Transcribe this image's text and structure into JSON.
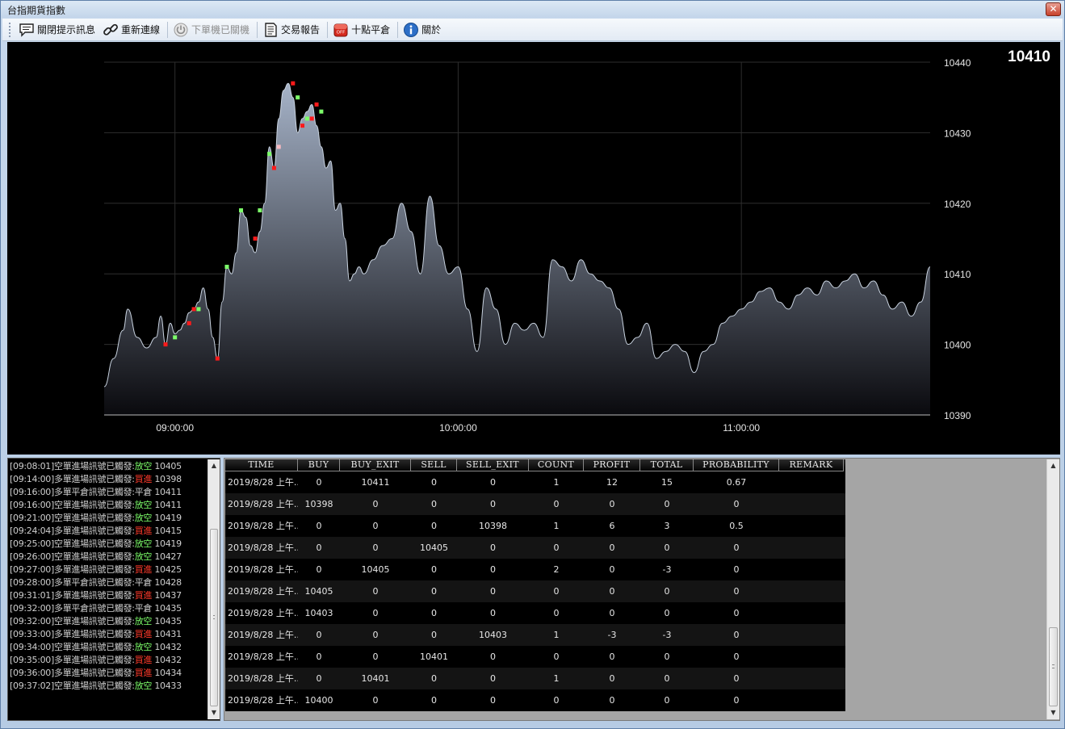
{
  "window": {
    "title": "台指期貨指數",
    "close_label": "✕"
  },
  "toolbar": {
    "items": [
      {
        "label": "關閉提示訊息",
        "icon": "message-icon",
        "disabled": false
      },
      {
        "label": "重新連線",
        "icon": "link-icon",
        "disabled": false
      },
      {
        "label": "下單機已關機",
        "icon": "power-icon",
        "disabled": true
      },
      {
        "label": "交易報告",
        "icon": "report-icon",
        "disabled": false
      },
      {
        "label": "十點平倉",
        "icon": "off-icon",
        "disabled": false
      },
      {
        "label": "關於",
        "icon": "info-icon",
        "disabled": false
      }
    ]
  },
  "price_display": {
    "current": "10410"
  },
  "chart_data": {
    "type": "area",
    "title": "",
    "xlabel": "",
    "ylabel": "",
    "x_axis": {
      "start": "08:45",
      "end": "11:40",
      "ticks": [
        "09:00:00",
        "10:00:00",
        "11:00:00"
      ]
    },
    "ylim": [
      10390,
      10440
    ],
    "y_ticks": [
      10390,
      10400,
      10410,
      10420,
      10430,
      10440
    ],
    "grid": true,
    "colors": {
      "area_top": "#a6b3c8",
      "area_bottom": "#0a0a0e",
      "line": "#c9d3e0",
      "grid": "#2e2e2e",
      "buy_marker": "#ff1a1a",
      "sell_marker": "#7dff6a",
      "exit_marker": "#f4b8c0"
    },
    "series": [
      {
        "x": [
          "08:45",
          "08:47",
          "08:49",
          "08:50",
          "08:52",
          "08:54",
          "08:56",
          "08:57",
          "08:58",
          "08:59",
          "09:00",
          "09:01",
          "09:02",
          "09:03",
          "09:04",
          "09:05",
          "09:06",
          "09:07",
          "09:08",
          "09:09",
          "09:10",
          "09:11",
          "09:12",
          "09:13",
          "09:14",
          "09:15",
          "09:16",
          "09:17",
          "09:18",
          "09:19",
          "09:20",
          "09:21",
          "09:22",
          "09:23",
          "09:24",
          "09:25",
          "09:26",
          "09:27",
          "09:28",
          "09:29",
          "09:30",
          "09:31",
          "09:32",
          "09:33",
          "09:34",
          "09:35",
          "09:36",
          "09:37",
          "09:38",
          "09:39",
          "09:40",
          "09:42",
          "09:44",
          "09:46",
          "09:48",
          "09:50",
          "09:52",
          "09:54",
          "09:56",
          "09:58",
          "10:00",
          "10:02",
          "10:04",
          "10:06",
          "10:08",
          "10:10",
          "10:12",
          "10:14",
          "10:16",
          "10:18",
          "10:20",
          "10:22",
          "10:24",
          "10:26",
          "10:28",
          "10:30",
          "10:32",
          "10:34",
          "10:36",
          "10:38",
          "10:40",
          "10:42",
          "10:44",
          "10:46",
          "10:48",
          "10:50",
          "10:52",
          "10:54",
          "10:56",
          "10:58",
          "11:00",
          "11:02",
          "11:04",
          "11:06",
          "11:08",
          "11:10",
          "11:12",
          "11:14",
          "11:16",
          "11:18",
          "11:20",
          "11:22",
          "11:24",
          "11:26",
          "11:28",
          "11:30",
          "11:32",
          "11:34",
          "11:36",
          "11:38",
          "11:40"
        ],
        "values": [
          10394,
          10398,
          10402,
          10405,
          10401,
          10399.5,
          10401,
          10404,
          10400,
          10403,
          10401.5,
          10402,
          10403,
          10404.5,
          10405,
          10406,
          10408,
          10405,
          10401,
          10398,
          10406,
          10411,
          10410,
          10413,
          10419,
          10418,
          10414,
          10413,
          10416,
          10420,
          10428,
          10425,
          10432,
          10436,
          10437,
          10435,
          10430,
          10432,
          10433,
          10434,
          10431,
          10428,
          10425,
          10426,
          10419,
          10420,
          10415,
          10409,
          10410,
          10411,
          10410,
          10412,
          10414,
          10415,
          10420,
          10416,
          10410,
          10421,
          10414,
          10410,
          10411,
          10405,
          10399,
          10408,
          10405,
          10400,
          10403,
          10402,
          10403,
          10401,
          10412,
          10411,
          10409,
          10412,
          10410,
          10409,
          10408,
          10405,
          10400,
          10401,
          10403,
          10398,
          10399,
          10400,
          10399,
          10396,
          10399,
          10400,
          10403,
          10404,
          10405,
          10406,
          10407.5,
          10408,
          10406,
          10405,
          10407,
          10408,
          10407,
          10409,
          10408,
          10409,
          10410,
          10408,
          10409,
          10407,
          10405,
          10406,
          10404,
          10406,
          10411
        ]
      }
    ],
    "markers": [
      {
        "t": "08:58",
        "v": 10400,
        "kind": "buy"
      },
      {
        "t": "09:00",
        "v": 10401,
        "kind": "sell"
      },
      {
        "t": "09:03",
        "v": 10403,
        "kind": "buy"
      },
      {
        "t": "09:04",
        "v": 10405,
        "kind": "buy"
      },
      {
        "t": "09:05",
        "v": 10405,
        "kind": "sell"
      },
      {
        "t": "09:09",
        "v": 10398,
        "kind": "buy"
      },
      {
        "t": "09:11",
        "v": 10411,
        "kind": "sell"
      },
      {
        "t": "09:14",
        "v": 10419,
        "kind": "sell"
      },
      {
        "t": "09:17",
        "v": 10415,
        "kind": "buy"
      },
      {
        "t": "09:18",
        "v": 10419,
        "kind": "sell"
      },
      {
        "t": "09:20",
        "v": 10427,
        "kind": "sell"
      },
      {
        "t": "09:21",
        "v": 10425,
        "kind": "buy"
      },
      {
        "t": "09:22",
        "v": 10428,
        "kind": "exit"
      },
      {
        "t": "09:25",
        "v": 10437,
        "kind": "buy"
      },
      {
        "t": "09:26",
        "v": 10435,
        "kind": "sell"
      },
      {
        "t": "09:27",
        "v": 10431,
        "kind": "buy"
      },
      {
        "t": "09:28",
        "v": 10432,
        "kind": "sell"
      },
      {
        "t": "09:29",
        "v": 10432,
        "kind": "buy"
      },
      {
        "t": "09:30",
        "v": 10434,
        "kind": "buy"
      },
      {
        "t": "09:31",
        "v": 10433,
        "kind": "sell"
      }
    ]
  },
  "log": {
    "lines": [
      {
        "time": "[09:08:01]",
        "msg": "空單進場訊號已觸發:",
        "action": "放空",
        "price": "10405",
        "kind": "short"
      },
      {
        "time": "[09:14:00]",
        "msg": "多單進場訊號已觸發:",
        "action": "買進",
        "price": "10398",
        "kind": "long"
      },
      {
        "time": "[09:16:00]",
        "msg": "多單平倉訊號已觸發:",
        "action": "平倉",
        "price": "10411",
        "kind": "flat"
      },
      {
        "time": "[09:16:00]",
        "msg": "空單進場訊號已觸發:",
        "action": "放空",
        "price": "10411",
        "kind": "short"
      },
      {
        "time": "[09:21:00]",
        "msg": "空單進場訊號已觸發:",
        "action": "放空",
        "price": "10419",
        "kind": "short"
      },
      {
        "time": "[09:24:04]",
        "msg": "多單進場訊號已觸發:",
        "action": "買進",
        "price": "10415",
        "kind": "long"
      },
      {
        "time": "[09:25:00]",
        "msg": "空單進場訊號已觸發:",
        "action": "放空",
        "price": "10419",
        "kind": "short"
      },
      {
        "time": "[09:26:00]",
        "msg": "空單進場訊號已觸發:",
        "action": "放空",
        "price": "10427",
        "kind": "short"
      },
      {
        "time": "[09:27:00]",
        "msg": "多單進場訊號已觸發:",
        "action": "買進",
        "price": "10425",
        "kind": "long"
      },
      {
        "time": "[09:28:00]",
        "msg": "多單平倉訊號已觸發:",
        "action": "平倉",
        "price": "10428",
        "kind": "flat"
      },
      {
        "time": "[09:31:01]",
        "msg": "多單進場訊號已觸發:",
        "action": "買進",
        "price": "10437",
        "kind": "long"
      },
      {
        "time": "[09:32:00]",
        "msg": "多單平倉訊號已觸發:",
        "action": "平倉",
        "price": "10435",
        "kind": "flat"
      },
      {
        "time": "[09:32:00]",
        "msg": "空單進場訊號已觸發:",
        "action": "放空",
        "price": "10435",
        "kind": "short"
      },
      {
        "time": "[09:33:00]",
        "msg": "多單進場訊號已觸發:",
        "action": "買進",
        "price": "10431",
        "kind": "long"
      },
      {
        "time": "[09:34:00]",
        "msg": "空單進場訊號已觸發:",
        "action": "放空",
        "price": "10432",
        "kind": "short"
      },
      {
        "time": "[09:35:00]",
        "msg": "多單進場訊號已觸發:",
        "action": "買進",
        "price": "10432",
        "kind": "long"
      },
      {
        "time": "[09:36:00]",
        "msg": "多單進場訊號已觸發:",
        "action": "買進",
        "price": "10434",
        "kind": "long"
      },
      {
        "time": "[09:37:02]",
        "msg": "空單進場訊號已觸發:",
        "action": "放空",
        "price": "10433",
        "kind": "short"
      }
    ]
  },
  "trade_table": {
    "columns": [
      "TIME",
      "BUY",
      "BUY_EXIT",
      "SELL",
      "SELL_EXIT",
      "COUNT",
      "PROFIT",
      "TOTAL",
      "PROBABILITY",
      "REMARK"
    ],
    "rows": [
      [
        "2019/8/28 上午...",
        "0",
        "10411",
        "0",
        "0",
        "1",
        "12",
        "15",
        "0.67",
        ""
      ],
      [
        "2019/8/28 上午...",
        "10398",
        "0",
        "0",
        "0",
        "0",
        "0",
        "0",
        "0",
        ""
      ],
      [
        "2019/8/28 上午...",
        "0",
        "0",
        "0",
        "10398",
        "1",
        "6",
        "3",
        "0.5",
        ""
      ],
      [
        "2019/8/28 上午...",
        "0",
        "0",
        "10405",
        "0",
        "0",
        "0",
        "0",
        "0",
        ""
      ],
      [
        "2019/8/28 上午...",
        "0",
        "10405",
        "0",
        "0",
        "2",
        "0",
        "-3",
        "0",
        ""
      ],
      [
        "2019/8/28 上午...",
        "10405",
        "0",
        "0",
        "0",
        "0",
        "0",
        "0",
        "0",
        ""
      ],
      [
        "2019/8/28 上午...",
        "10403",
        "0",
        "0",
        "0",
        "0",
        "0",
        "0",
        "0",
        ""
      ],
      [
        "2019/8/28 上午...",
        "0",
        "0",
        "0",
        "10403",
        "1",
        "-3",
        "-3",
        "0",
        ""
      ],
      [
        "2019/8/28 上午...",
        "0",
        "0",
        "10401",
        "0",
        "0",
        "0",
        "0",
        "0",
        ""
      ],
      [
        "2019/8/28 上午...",
        "0",
        "10401",
        "0",
        "0",
        "1",
        "0",
        "0",
        "0",
        ""
      ],
      [
        "2019/8/28 上午...",
        "10400",
        "0",
        "0",
        "0",
        "0",
        "0",
        "0",
        "0",
        ""
      ]
    ]
  }
}
